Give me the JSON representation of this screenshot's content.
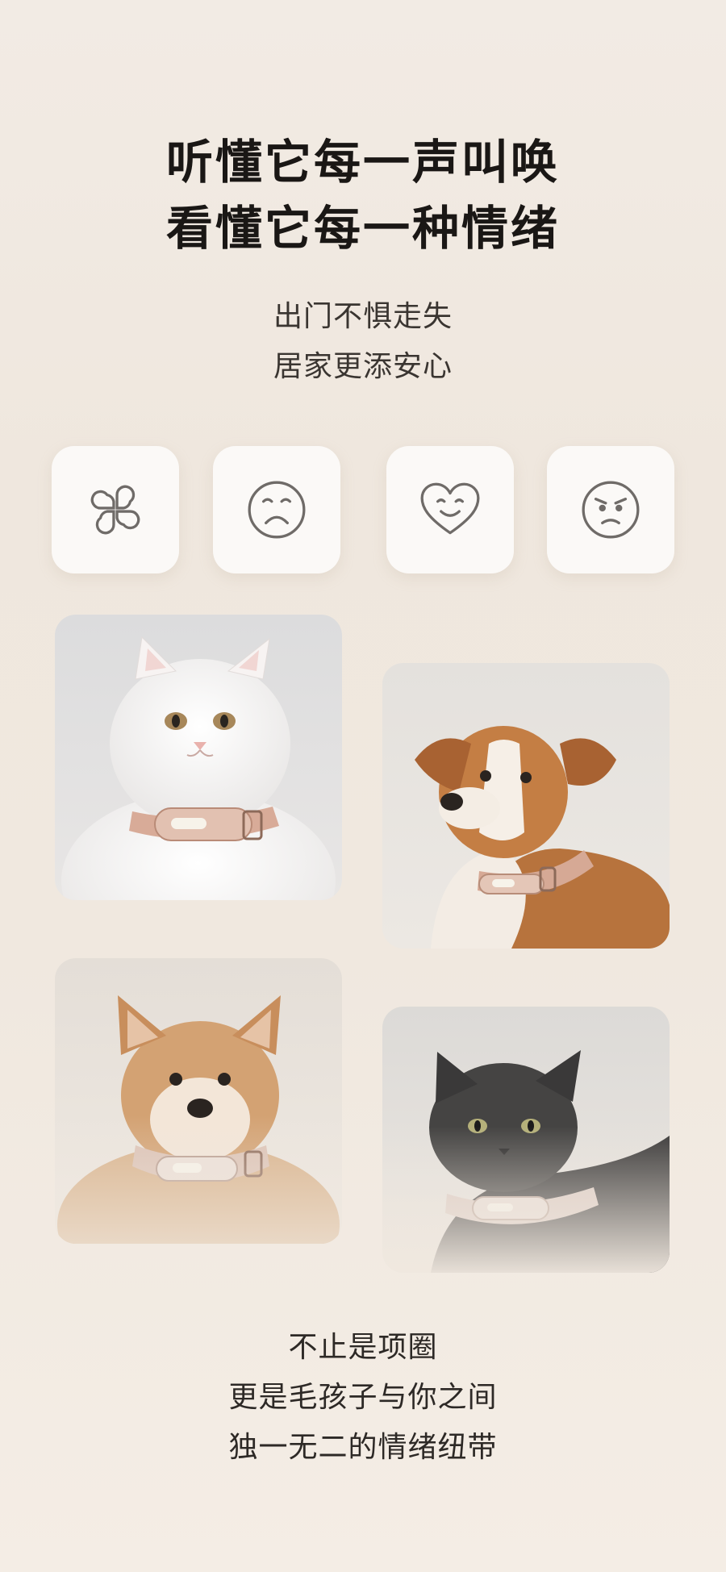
{
  "headline": {
    "line1": "听懂它每一声叫唤",
    "line2": "看懂它每一种情绪"
  },
  "subhead": {
    "line1": "出门不惧走失",
    "line2": "居家更添安心"
  },
  "emotion_icons": [
    {
      "icon": "clover-icon"
    },
    {
      "icon": "sad-face-icon"
    },
    {
      "icon": "heart-smile-icon"
    },
    {
      "icon": "angry-face-icon"
    }
  ],
  "photos": [
    {
      "subject": "white-cat-with-collar"
    },
    {
      "subject": "brown-white-dog-with-collar"
    },
    {
      "subject": "shiba-puppy-with-collar"
    },
    {
      "subject": "black-cat-with-collar"
    }
  ],
  "tagline": {
    "line1": "不止是项圈",
    "line2": "更是毛孩子与你之间",
    "line3": "独一无二的情绪纽带"
  },
  "colors": {
    "background": "#f0e8df",
    "card": "#fbf9f7",
    "icon_stroke": "#6f6b68",
    "collar": "#c9a18f"
  }
}
